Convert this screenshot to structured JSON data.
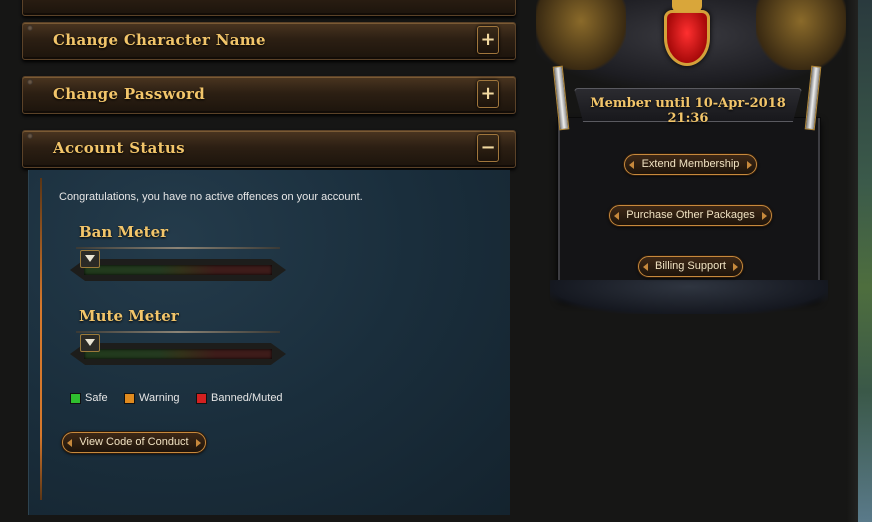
{
  "sections": {
    "change_name": {
      "title": "Change Character Name",
      "toggle": "+"
    },
    "change_password": {
      "title": "Change Password",
      "toggle": "+"
    },
    "account_status": {
      "title": "Account Status",
      "toggle": "−"
    }
  },
  "account_status": {
    "intro": "Congratulations, you have no active offences on your account.",
    "ban_meter": {
      "label": "Ban Meter",
      "level": 0
    },
    "mute_meter": {
      "label": "Mute Meter",
      "level": 0
    },
    "legend": [
      {
        "label": "Safe",
        "color": "#2fbf2f"
      },
      {
        "label": "Warning",
        "color": "#e08a1e"
      },
      {
        "label": "Banned/Muted",
        "color": "#d42020"
      }
    ],
    "conduct_button": "View Code of Conduct"
  },
  "membership": {
    "status": "Member until 10-Apr-2018 21:36",
    "buttons": {
      "extend": "Extend Membership",
      "packages": "Purchase Other Packages",
      "billing": "Billing Support"
    }
  }
}
